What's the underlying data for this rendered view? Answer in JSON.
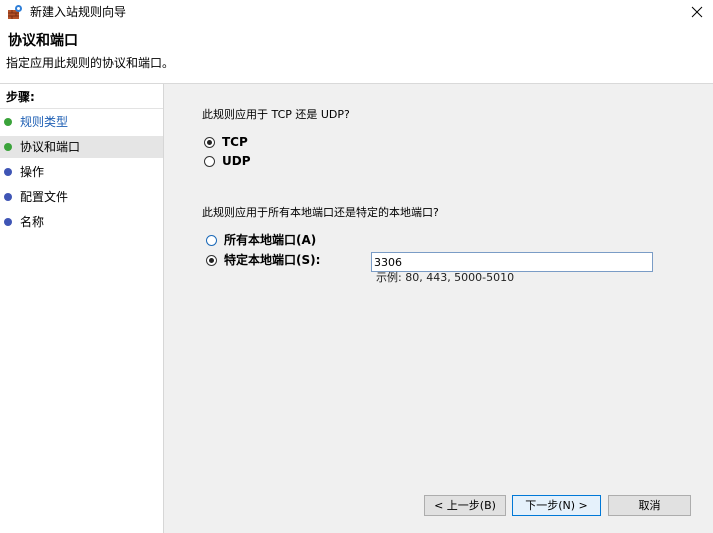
{
  "window": {
    "title": "新建入站规则向导"
  },
  "header": {
    "title": "协议和端口",
    "subtitle": "指定应用此规则的协议和端口。"
  },
  "steps": {
    "title": "步骤:",
    "items": [
      {
        "label": "规则类型",
        "state": "done"
      },
      {
        "label": "协议和端口",
        "state": "current"
      },
      {
        "label": "操作",
        "state": "pending"
      },
      {
        "label": "配置文件",
        "state": "pending"
      },
      {
        "label": "名称",
        "state": "pending"
      }
    ]
  },
  "protocol": {
    "question": "此规则应用于 TCP 还是 UDP?",
    "options": [
      {
        "label": "TCP",
        "checked": true
      },
      {
        "label": "UDP",
        "checked": false
      }
    ]
  },
  "ports": {
    "question": "此规则应用于所有本地端口还是特定的本地端口?",
    "options": [
      {
        "label": "所有本地端口(A)",
        "checked": false
      },
      {
        "label": "特定本地端口(S):",
        "checked": true
      }
    ],
    "specific_value": "3306",
    "example": "示例: 80, 443, 5000-5010"
  },
  "buttons": {
    "back": "< 上一步(B)",
    "next": "下一步(N) >",
    "cancel": "取消"
  },
  "colors": {
    "bullet_done": "#3aa33a",
    "bullet_current": "#3aa33a",
    "bullet_pending": "#3f55b5",
    "step_done_text": "#1e5fb4",
    "right_panel_bg": "#f0f0f0"
  },
  "icons": {
    "app": "firewall-icon",
    "close": "close-icon"
  }
}
